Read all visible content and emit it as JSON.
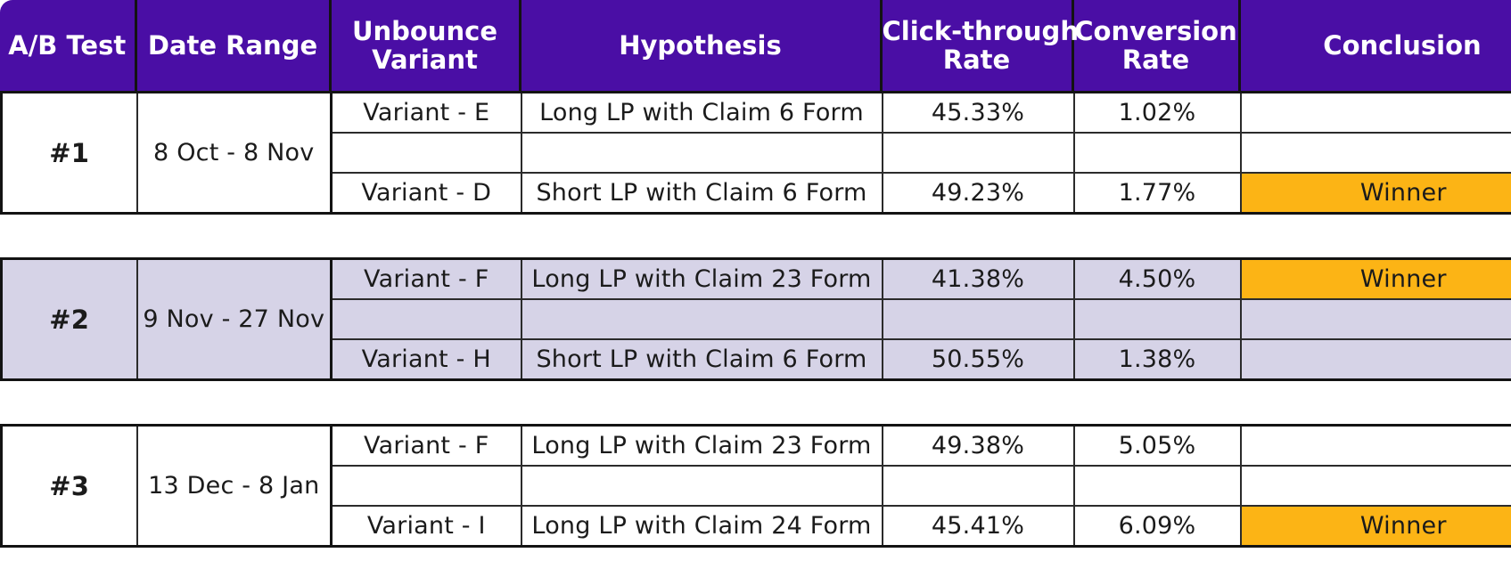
{
  "table": {
    "columns": [
      {
        "key": "test",
        "label": "A/B Test"
      },
      {
        "key": "date",
        "label": "Date Range"
      },
      {
        "key": "variant",
        "label": "Unbounce\nVariant",
        "line1": "Unbounce",
        "line2": "Variant"
      },
      {
        "key": "hypothesis",
        "label": "Hypothesis"
      },
      {
        "key": "ctr",
        "label": "Click-through\nRate",
        "line1": "Click-through",
        "line2": "Rate"
      },
      {
        "key": "cvr",
        "label": "Conversion\nRate",
        "line1": "Conversion",
        "line2": "Rate"
      },
      {
        "key": "conclusion",
        "label": "Conclusion"
      }
    ],
    "header_bg": "#4A0EA5",
    "header_fg": "#FFFFFF",
    "winner_bg": "#FCB415",
    "highlight_bg": "#D6D3E7",
    "blocks": [
      {
        "test": "#1",
        "date_range": "8 Oct - 8 Nov",
        "highlighted": false,
        "rows": [
          {
            "variant": "Variant - E",
            "hypothesis": "Long LP with Claim 6 Form",
            "ctr": "45.33%",
            "cvr": "1.02%",
            "conclusion": "",
            "winner": false
          },
          {
            "variant": "",
            "hypothesis": "",
            "ctr": "",
            "cvr": "",
            "conclusion": "",
            "winner": false
          },
          {
            "variant": "Variant - D",
            "hypothesis": "Short LP with Claim 6 Form",
            "ctr": "49.23%",
            "cvr": "1.77%",
            "conclusion": "Winner",
            "winner": true
          }
        ]
      },
      {
        "test": "#2",
        "date_range": "9 Nov - 27 Nov",
        "highlighted": true,
        "rows": [
          {
            "variant": "Variant - F",
            "hypothesis": "Long LP with Claim 23 Form",
            "ctr": "41.38%",
            "cvr": "4.50%",
            "conclusion": "Winner",
            "winner": true
          },
          {
            "variant": "",
            "hypothesis": "",
            "ctr": "",
            "cvr": "",
            "conclusion": "",
            "winner": false
          },
          {
            "variant": "Variant - H",
            "hypothesis": "Short LP with Claim 6 Form",
            "ctr": "50.55%",
            "cvr": "1.38%",
            "conclusion": "",
            "winner": false
          }
        ]
      },
      {
        "test": "#3",
        "date_range": "13 Dec - 8 Jan",
        "highlighted": false,
        "rows": [
          {
            "variant": "Variant - F",
            "hypothesis": "Long LP with Claim 23 Form",
            "ctr": "49.38%",
            "cvr": "5.05%",
            "conclusion": "",
            "winner": false
          },
          {
            "variant": "",
            "hypothesis": "",
            "ctr": "",
            "cvr": "",
            "conclusion": "",
            "winner": false
          },
          {
            "variant": "Variant - I",
            "hypothesis": "Long LP with Claim 24 Form",
            "ctr": "45.41%",
            "cvr": "6.09%",
            "conclusion": "Winner",
            "winner": true
          }
        ]
      }
    ]
  }
}
